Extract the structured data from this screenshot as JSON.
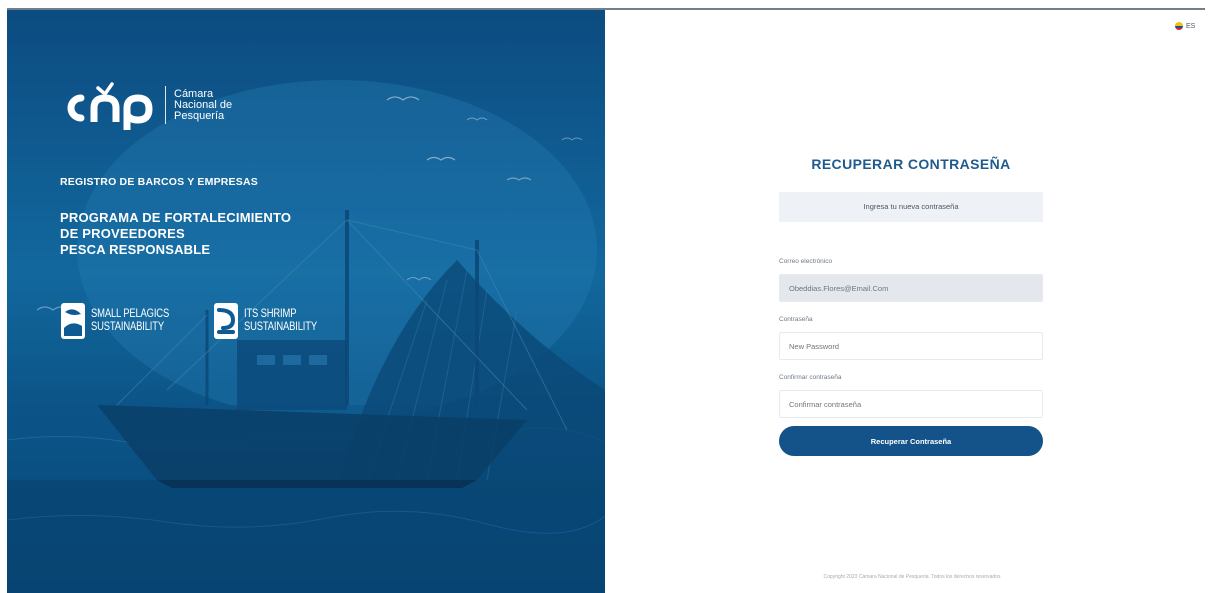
{
  "hero": {
    "brand": {
      "logo_text": "cnp",
      "name_lines": [
        "Cámara",
        "Nacional de",
        "Pesquería"
      ]
    },
    "registro": "REGISTRO DE BARCOS Y EMPRESAS",
    "programa_lines": [
      "PROGRAMA DE FORTALECIMIENTO",
      "DE PROVEEDORES",
      "PESCA RESPONSABLE"
    ],
    "badges": [
      {
        "lines": [
          "SMALL PELAGICS",
          "SUSTAINABILITY"
        ],
        "icon": "small-pelagics-icon"
      },
      {
        "lines": [
          "ITS SHRIMP",
          "SUSTAINABILITY"
        ],
        "icon": "shrimp-icon"
      }
    ]
  },
  "language": {
    "code": "ES",
    "icon": "ecuador-flag-icon"
  },
  "form": {
    "title": "RECUPERAR CONTRASEÑA",
    "notice": "Ingresa tu nueva contraseña",
    "email_label": "Correo electrónico",
    "email_value": "Obeddias.Flores@Email.Com",
    "password_label": "Contraseña",
    "password_placeholder": "New Password",
    "confirm_label": "Confirmar contraseña",
    "confirm_placeholder": "Confirmar contraseña",
    "submit_label": "Recuperar Contraseña"
  },
  "footer": "Copyright 2023 Cámara Nacional de Pesquería. Todos los derechos reservados",
  "colors": {
    "brand_blue": "#13538a",
    "title_blue": "#1f5c8d",
    "notice_bg": "#eef2f6"
  }
}
